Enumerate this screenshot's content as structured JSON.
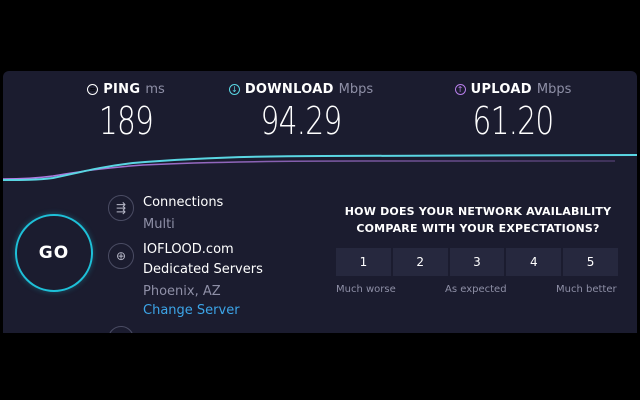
{
  "metrics": {
    "ping": {
      "label": "PING",
      "unit": "ms",
      "value": "189",
      "icon": "ping-icon"
    },
    "download": {
      "label": "DOWNLOAD",
      "unit": "Mbps",
      "value": "94.29",
      "icon": "download-arrow-icon"
    },
    "upload": {
      "label": "UPLOAD",
      "unit": "Mbps",
      "value": "61.20",
      "icon": "upload-arrow-icon"
    }
  },
  "colors": {
    "download": "#5ad6e3",
    "upload": "#b57de8",
    "accent": "#1ec0d8",
    "panel": "#1b1c2f"
  },
  "go": {
    "label": "GO"
  },
  "connections": {
    "label": "Connections",
    "mode": "Multi",
    "icon": "connections-icon"
  },
  "server": {
    "host": "IOFLOOD.com",
    "type": "Dedicated Servers",
    "location": "Phoenix, AZ",
    "change_label": "Change Server",
    "icon": "globe-icon"
  },
  "survey": {
    "question": "HOW DOES YOUR NETWORK AVAILABILITY COMPARE WITH YOUR EXPECTATIONS?",
    "options": [
      "1",
      "2",
      "3",
      "4",
      "5"
    ],
    "low_label": "Much worse",
    "mid_label": "As expected",
    "high_label": "Much better"
  }
}
